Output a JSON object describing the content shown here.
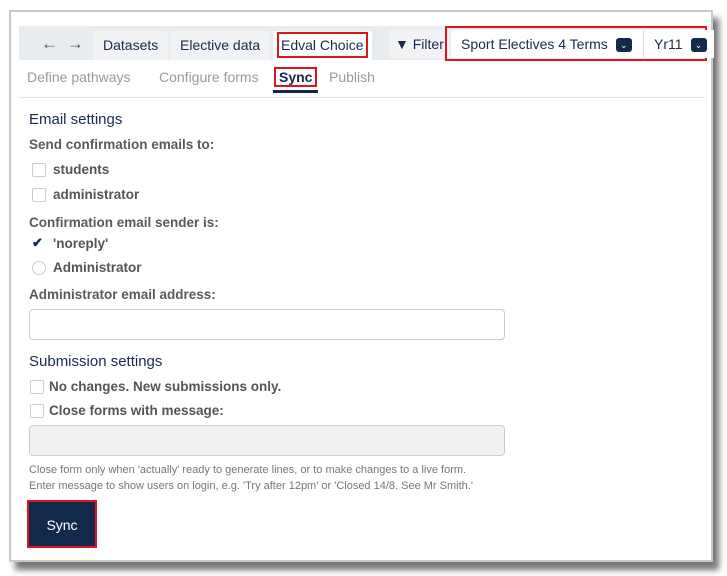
{
  "nav": {
    "back": "←",
    "forward": "→"
  },
  "tabs": [
    {
      "label": "Datasets"
    },
    {
      "label": "Elective data"
    },
    {
      "label": "Edval Choice"
    }
  ],
  "filter": {
    "label": "Filter",
    "icon": "filter-icon"
  },
  "selects": {
    "dataset": "Sport Electives 4 Terms",
    "year": "Yr11"
  },
  "subtabs": [
    "Define pathways",
    "Configure forms",
    "Sync",
    "Publish"
  ],
  "email": {
    "heading": "Email settings",
    "send_label": "Send confirmation emails to:",
    "send_options": [
      {
        "label": "students",
        "checked": false
      },
      {
        "label": "administrator",
        "checked": false
      }
    ],
    "sender_label": "Confirmation email sender is:",
    "sender_options": [
      {
        "label": "'noreply'",
        "selected": true
      },
      {
        "label": "Administrator",
        "selected": false
      }
    ],
    "admin_email_label": "Administrator email address:",
    "admin_email_value": ""
  },
  "submission": {
    "heading": "Submission settings",
    "options": [
      {
        "label": "No changes. New submissions only.",
        "checked": false
      },
      {
        "label": "Close forms with message:",
        "checked": false
      }
    ],
    "message_value": "",
    "help1": "Close form only when 'actually' ready to generate lines, or to make changes to a live form.",
    "help2": "Enter message to show users on login, e.g. 'Try after 12pm' or 'Closed 14/8. See Mr Smith.'"
  },
  "sync_button": "Sync",
  "colors": {
    "primary": "#13294b",
    "highlight": "#e0141e"
  }
}
